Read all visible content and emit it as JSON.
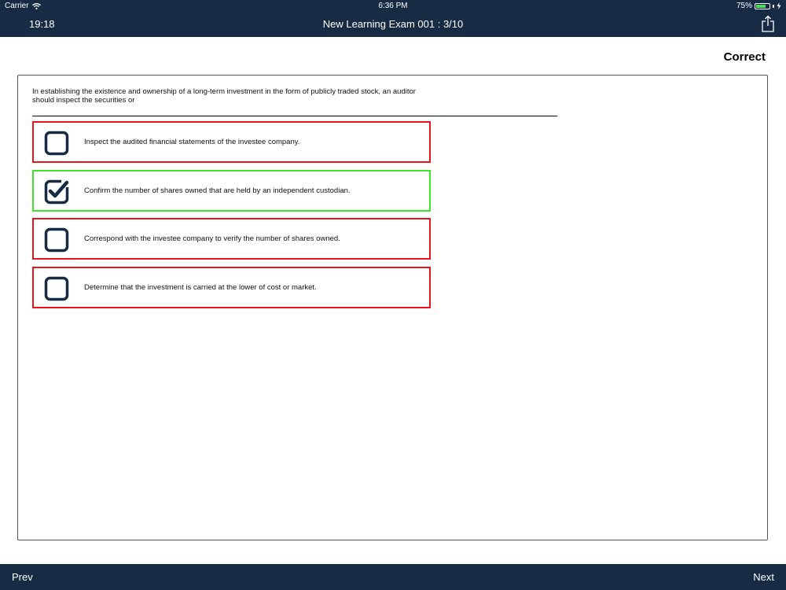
{
  "status_bar": {
    "carrier": "Carrier",
    "clock": "6:36 PM",
    "battery_text": "75%",
    "battery_level": 0.75
  },
  "header": {
    "timer": "19:18",
    "title": "New Learning Exam 001 : 3/10",
    "share_icon": "share-icon"
  },
  "result_label": "Correct",
  "question": {
    "text": "In establishing the existence and ownership of a long-term investment in the form of publicly traded stock, an auditor   should inspect the securities or"
  },
  "options": [
    {
      "text": "Inspect the audited financial statements of the investee company.",
      "checked": false,
      "state": "incorrect"
    },
    {
      "text": "Confirm the number of shares owned that are held by an independent custodian.",
      "checked": true,
      "state": "correct"
    },
    {
      "text": "Correspond with the investee company to verify the number of shares owned.",
      "checked": false,
      "state": "incorrect"
    },
    {
      "text": "Determine that the investment is carried at the lower of cost or market.",
      "checked": false,
      "state": "incorrect"
    }
  ],
  "footer": {
    "prev_label": "Prev",
    "next_label": "Next"
  },
  "colors": {
    "bar_background": "#172b45",
    "correct_border": "#3de62a",
    "incorrect_border": "#e8141b",
    "battery_fill": "#4cd964"
  }
}
